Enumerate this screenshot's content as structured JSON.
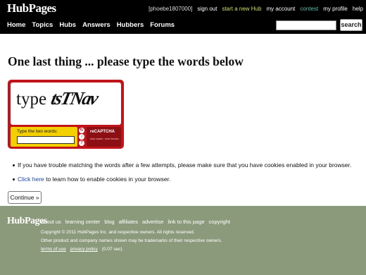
{
  "header": {
    "logo": "HubPages",
    "user_links": {
      "username": "[phoebe1807000]",
      "sign_out": "sign out",
      "start_hub": "start a new Hub",
      "my_account": "my account",
      "contest": "contest",
      "my_profile": "my profile",
      "help": "help"
    },
    "nav": [
      "Home",
      "Topics",
      "Hubs",
      "Answers",
      "Hubbers",
      "Forums"
    ],
    "search": {
      "value": "",
      "button_label": "search"
    }
  },
  "main": {
    "title": "One last thing ... please type the words below",
    "captcha": {
      "word1": "type",
      "word2": "tsTNav",
      "input_label": "Type the two words:",
      "input_value": "",
      "controls": [
        "refresh-icon",
        "audio-icon",
        "help-icon"
      ],
      "brand_title": "reCAPTCHA",
      "brand_tagline": "stop spam. read books."
    },
    "tips": {
      "tip1": "If you have trouble matching the words after a few attempts, please make sure that you have cookies enabled in your browser.",
      "tip2_link": "Click here",
      "tip2_rest": " to learn how to enable cookies in your browser."
    },
    "continue_label": "Continue »"
  },
  "footer": {
    "logo": "HubPages",
    "links": [
      "about us",
      "learning center",
      "blog",
      "affiliates",
      "advertise",
      "link to this page",
      "copyright"
    ],
    "copyright": "Copyright © 2011 HubPages Inc. and respective owners. All rights reserved.",
    "trademark": "Other product and company names shown may be trademarks of their respective owners.",
    "terms": "terms of use",
    "privacy": "privacy policy",
    "timing": "(0.07 sec)"
  },
  "colors": {
    "header_bg": "#000000",
    "link_green": "#c6e05f",
    "link_teal": "#5fbfb0",
    "captcha_red": "#c0141a",
    "captcha_yellow": "#f5d000",
    "footer_bg": "#8c9a7c",
    "link_blue": "#1a47a8"
  }
}
